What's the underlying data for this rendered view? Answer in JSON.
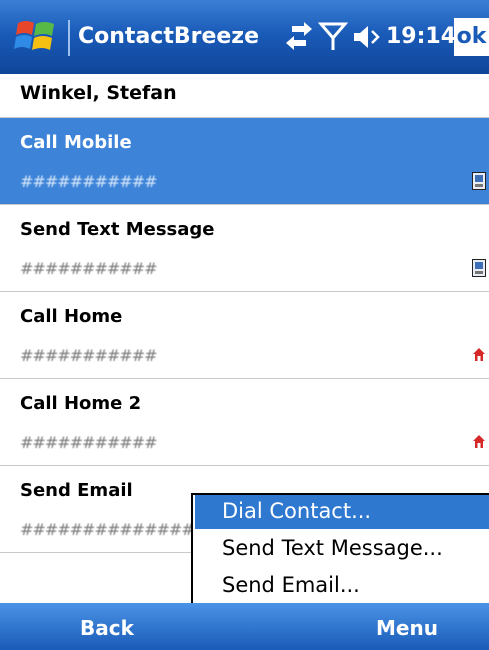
{
  "titlebar": {
    "app_title": "ContactBreeze",
    "clock": "19:14",
    "ok_label": "ok"
  },
  "contact": {
    "name": "Winkel, Stefan"
  },
  "actions": [
    {
      "label": "Call Mobile",
      "number": "###########",
      "icon": "mobile-phone-icon",
      "selected": true
    },
    {
      "label": "Send Text Message",
      "number": "###########",
      "icon": "mobile-phone-icon",
      "selected": false
    },
    {
      "label": "Call Home",
      "number": "###########",
      "icon": "home-icon",
      "selected": false
    },
    {
      "label": "Call Home 2",
      "number": "###########",
      "icon": "home-icon",
      "selected": false
    },
    {
      "label": "Send Email",
      "number": "######################",
      "icon": "",
      "selected": false
    }
  ],
  "popup_menu": {
    "items": [
      {
        "label": "Dial Contact..."
      },
      {
        "label": "Send Text Message..."
      },
      {
        "label": "Send Email..."
      }
    ]
  },
  "softkeys": {
    "left": "Back",
    "right": "Menu"
  },
  "colors": {
    "title_bar": "#1a5bb8",
    "selection": "#3d84d8",
    "menu_highlight": "#2f78d0",
    "home_icon": "#d62828"
  }
}
